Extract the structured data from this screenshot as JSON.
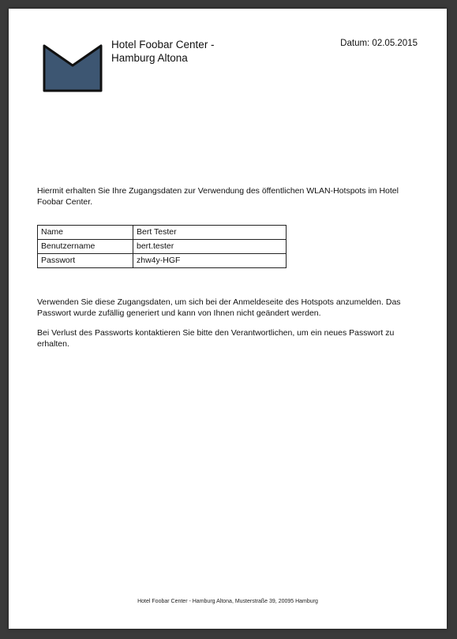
{
  "header": {
    "hotel_name": "Hotel Foobar Center -\nHamburg Altona",
    "date": "Datum: 02.05.2015"
  },
  "colors": {
    "logo_fill": "#3d5672",
    "logo_stroke": "#111111"
  },
  "intro_text": "Hiermit erhalten Sie Ihre Zugangsdaten zur Verwendung des öffentlichen WLAN-Hotspots im Hotel Foobar Center.",
  "credentials": [
    {
      "label": "Name",
      "value": "Bert Tester"
    },
    {
      "label": "Benutzername",
      "value": "bert.tester"
    },
    {
      "label": "Passwort",
      "value": "zhw4y-HGF"
    }
  ],
  "paragraph1": "Verwenden Sie diese Zugangsdaten, um sich bei der Anmeldeseite des Hotspots anzumelden. Das Passwort wurde zufällig generiert und kann von Ihnen nicht geändert werden.",
  "paragraph2": "Bei Verlust des Passworts kontaktieren Sie bitte den Verantwortlichen, um ein neues Passwort zu erhalten.",
  "footer": "Hotel Foobar Center - Hamburg Altona, Musterstraße 39, 20095 Hamburg"
}
